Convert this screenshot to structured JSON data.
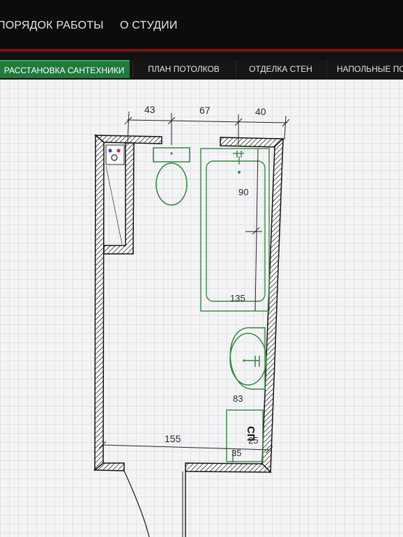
{
  "nav": {
    "items": [
      {
        "label": "ПОРЯДОК РАБОТЫ"
      },
      {
        "label": "О СТУДИИ"
      }
    ]
  },
  "tabs": [
    {
      "label": "РАССТАНОВКА САНТЕХНИКИ",
      "active": true
    },
    {
      "label": "ПЛАН ПОТОЛКОВ",
      "active": false
    },
    {
      "label": "ОТДЕЛКА СТЕН",
      "active": false
    },
    {
      "label": "НАПОЛЬНЫЕ ПО",
      "active": false
    }
  ],
  "plan": {
    "dimensions": {
      "top_left": "43",
      "top_middle": "67",
      "top_right": "40",
      "bath_width": "90",
      "bath_length": "135",
      "sink": "83",
      "room_width": "155",
      "cabinet_width": "25",
      "cabinet_depth": "35"
    },
    "cabinet_label": "СП"
  },
  "colors": {
    "fixture_green": "#2e8b3a",
    "wall": "#1a1a1a",
    "active_tab": "#1f7a3c",
    "accent_red": "#7a1414"
  }
}
